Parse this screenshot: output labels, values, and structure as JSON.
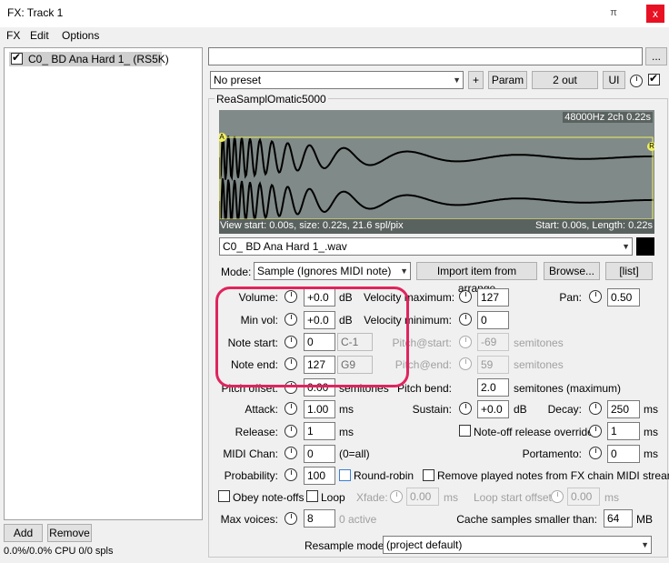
{
  "window": {
    "title": "FX: Track 1",
    "pin_icon": "pin-icon",
    "close_icon": "close-icon",
    "close_glyph": "x",
    "pin_glyph": "π"
  },
  "menu": [
    "FX",
    "Edit",
    "Options"
  ],
  "fx_chain": {
    "items": [
      {
        "label": "C0_ BD Ana Hard 1_ (RS5K)",
        "enabled": true
      }
    ]
  },
  "bottom": {
    "add_label": "Add",
    "remove_label": "Remove",
    "cpu_text": "0.0%/0.0% CPU 0/0 spls"
  },
  "toolbar": {
    "name_value": "",
    "more_label": "...",
    "preset_value": "No preset",
    "plus_label": "+",
    "param_label": "Param",
    "out_label": "2 out",
    "ui_label": "UI"
  },
  "plugin": {
    "name": "ReaSamplOmatic5000",
    "waveform": {
      "info_top": "48000Hz 2ch 0.22s",
      "info_left": "View start: 0.00s, size: 0.22s, 21.6 spl/pix",
      "info_right": "Start: 0.00s, Length: 0.22s",
      "marker_a": "A",
      "marker_r": "R"
    },
    "file_value": "C0_ BD Ana Hard 1_.wav",
    "mode_label": "Mode:",
    "mode_value": "Sample (Ignores MIDI note)",
    "import_label": "Import item from arrange",
    "browse_label": "Browse...",
    "list_label": "[list]",
    "volume": {
      "label": "Volume:",
      "value": "+0.0",
      "unit": "dB"
    },
    "min_vol": {
      "label": "Min vol:",
      "value": "+0.0",
      "unit": "dB"
    },
    "note_start": {
      "label": "Note start:",
      "value": "0",
      "note": "C-1"
    },
    "note_end": {
      "label": "Note end:",
      "value": "127",
      "note": "G9"
    },
    "pitch_offset": {
      "label": "Pitch offset:",
      "value": "0.00",
      "unit": "semitones"
    },
    "vel_max": {
      "label": "Velocity maximum:",
      "value": "127"
    },
    "vel_min": {
      "label": "Velocity minimum:",
      "value": "0"
    },
    "pitch_start": {
      "label": "Pitch@start:",
      "value": "-69",
      "unit": "semitones"
    },
    "pitch_end": {
      "label": "Pitch@end:",
      "value": "59",
      "unit": "semitones"
    },
    "pitch_bend": {
      "label": "Pitch bend:",
      "value": "2.0",
      "unit": "semitones (maximum)"
    },
    "pan": {
      "label": "Pan:",
      "value": "0.50"
    },
    "attack": {
      "label": "Attack:",
      "value": "1.00",
      "unit": "ms"
    },
    "sustain": {
      "label": "Sustain:",
      "value": "+0.0",
      "unit": "dB"
    },
    "decay": {
      "label": "Decay:",
      "value": "250",
      "unit": "ms"
    },
    "release": {
      "label": "Release:",
      "value": "1",
      "unit": "ms"
    },
    "noteoff_override": {
      "label": "Note-off release override:",
      "value": "1",
      "unit": "ms"
    },
    "midi_chan": {
      "label": "MIDI Chan:",
      "value": "0",
      "note": "(0=all)"
    },
    "portamento": {
      "label": "Portamento:",
      "value": "0",
      "unit": "ms"
    },
    "probability": {
      "label": "Probability:",
      "value": "100"
    },
    "round_robin": {
      "label": "Round-robin"
    },
    "remove_played": {
      "label": "Remove played notes from FX chain MIDI stream"
    },
    "obey_noteoffs": {
      "label": "Obey note-offs"
    },
    "loop": {
      "label": "Loop"
    },
    "xfade": {
      "label": "Xfade:",
      "value": "0.00",
      "unit": "ms"
    },
    "loop_start": {
      "label": "Loop start offset:",
      "value": "0.00",
      "unit": "ms"
    },
    "max_voices": {
      "label": "Max voices:",
      "value": "8",
      "active": "0 active"
    },
    "cache": {
      "label": "Cache samples smaller than:",
      "value": "64",
      "unit": "MB"
    },
    "resample": {
      "label": "Resample mode:",
      "value": "(project default)"
    }
  },
  "colors": {
    "highlight": "#e0245e",
    "waveform_bg": "#808a88",
    "selection": "#f0f060"
  }
}
